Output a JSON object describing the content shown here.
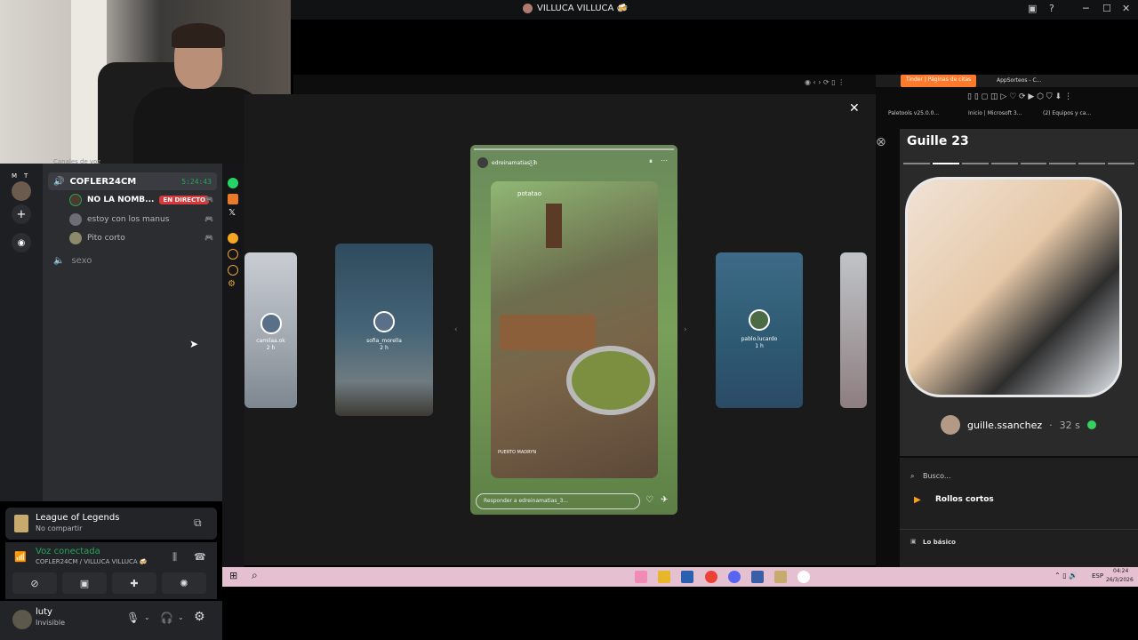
{
  "window": {
    "title": "VILLUCA VILLUCA 🍻"
  },
  "discord": {
    "rail": {
      "letters": [
        "M",
        "T"
      ]
    },
    "section_label": "Canales de voz",
    "voice_channel": {
      "name": "COFLER24CM",
      "time": "5:24:43"
    },
    "members": [
      {
        "name": "NO LA NOMB...",
        "badge": "EN DIRECTO"
      },
      {
        "name": "estoy con los manus"
      },
      {
        "name": "Pito corto"
      }
    ],
    "other_channel": "sexo",
    "activity": {
      "game": "League of Legends",
      "status": "No compartir"
    },
    "voice": {
      "status": "Voz conectada",
      "channel": "COFLER24CM / VILLUCA VILLUCA 🍻"
    },
    "user": {
      "name": "luty",
      "status": "Invisible"
    }
  },
  "stories": {
    "main_user": "edreinamatias_3",
    "main_time": "3 h",
    "main_sticker_top": "potatao",
    "main_location": "PUERTO MADRYN",
    "reply_placeholder": "Responder a edreinamatias_3...",
    "left_far": {
      "user": "camilaa.ok",
      "time": "2 h"
    },
    "left": {
      "user": "sofia_morella",
      "time": "2 h"
    },
    "right": {
      "user": "pablo.lucardo",
      "time": "1 h"
    }
  },
  "right_browser": {
    "tab_active": "Tinder | Páginas de citas",
    "tab_other": "AppSorteos - C...",
    "bookmarks": [
      "Paletools v25.0.0...",
      "Inicio | Microsoft 3...",
      "(2) Equipos y ca..."
    ],
    "story_title": "Guille 23",
    "story_user": "guille.ssanchez",
    "story_time": "32 s",
    "search_label": "Busco...",
    "reels_label": "Rollos cortos",
    "basics_label": "Lo básico"
  },
  "taskbar": {
    "lang": "ESP",
    "time": "04:24",
    "date": "26/3/2026"
  },
  "colors": {
    "live": "#da373c",
    "online": "#23a55a",
    "tinder": "#ff7a2a",
    "taskbar": "#e4c0d0"
  }
}
